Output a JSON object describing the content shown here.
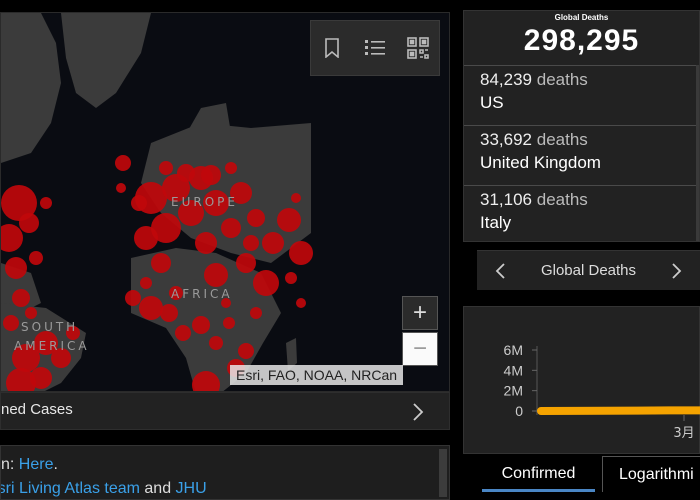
{
  "map": {
    "labels": {
      "europe": "EUROPE",
      "africa": "AFRICA",
      "south": "SOUTH",
      "america": "AMERICA"
    },
    "toolbar": {
      "bookmark_icon": "bookmark-icon",
      "list_icon": "list-icon",
      "grid_icon": "qr-grid-icon"
    },
    "zoom_in": "+",
    "zoom_out": "−",
    "attribution": "Esri, FAO, NOAA, NRCan",
    "marker_color": "#c0080b",
    "land_color": "#3b3b3b",
    "ocean_color": "#0a0c12"
  },
  "map_bottom": {
    "title": "ned Cases"
  },
  "info": {
    "line1_prefix": "n: ",
    "line1_link": "Here",
    "line1_suffix": ".",
    "line2_link1": "Esri Living Atlas team",
    "line2_mid": " and ",
    "line2_link2": "JHU"
  },
  "deaths": {
    "caption": "Global Deaths",
    "total": "298,295",
    "unit": "deaths",
    "rows": [
      {
        "count": "84,239",
        "country": "US"
      },
      {
        "count": "33,692",
        "country": "United Kingdom"
      },
      {
        "count": "31,106",
        "country": "Italy"
      }
    ]
  },
  "deaths_nav": {
    "label": "Global Deaths"
  },
  "chart_data": {
    "type": "line",
    "title": "",
    "xlabel": "",
    "ylabel": "",
    "y_ticks": [
      "6M",
      "4M",
      "2M",
      "0"
    ],
    "x_ticks": [
      "3月"
    ],
    "ylim": [
      0,
      6000000
    ],
    "series": [
      {
        "color": "#f5a300",
        "values": [
          0,
          5000,
          20000,
          40000,
          60000,
          60000
        ]
      }
    ]
  },
  "tabs": {
    "confirmed": "Confirmed",
    "logarithmic": "Logarithmi"
  },
  "colors": {
    "accent_blue": "#3aa0e8",
    "tab_underline": "#4a86c5",
    "series_orange": "#f5a300"
  }
}
